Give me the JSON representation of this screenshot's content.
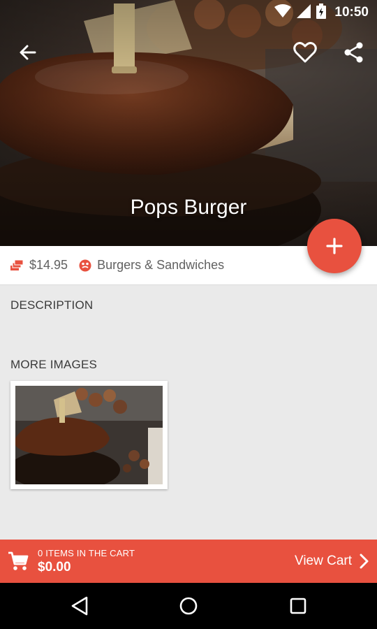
{
  "status_bar": {
    "time": "10:50",
    "icons": [
      "wifi-icon",
      "signal-icon",
      "battery-icon"
    ]
  },
  "toolbar": {
    "back_icon": "arrow-back-icon",
    "favorite_icon": "heart-outline-icon",
    "share_icon": "share-icon"
  },
  "product": {
    "name": "Pops Burger",
    "price": "$14.95",
    "category": "Burgers & Sandwiches"
  },
  "sections": {
    "description_heading": "DESCRIPTION",
    "more_images_heading": "MORE IMAGES"
  },
  "fab": {
    "icon": "plus-icon"
  },
  "cart": {
    "items_text": "0 ITEMS IN THE CART",
    "total": "$0.00",
    "view_label": "View Cart"
  },
  "colors": {
    "accent": "#e8513f",
    "info_text": "#616161"
  }
}
